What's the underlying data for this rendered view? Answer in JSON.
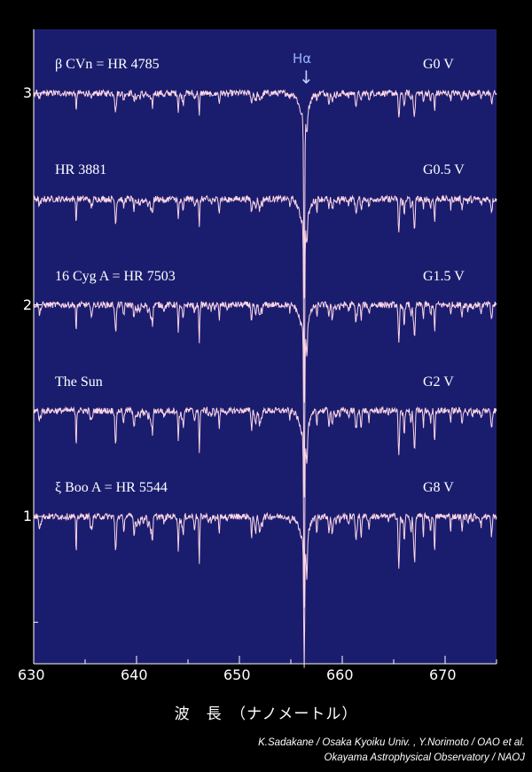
{
  "chart_data": {
    "type": "line",
    "title": "",
    "xlabel": "波　長　（ナノメートル）",
    "ylabel": "",
    "xlim": [
      630,
      675
    ],
    "ylim": [
      0.2,
      3.6
    ],
    "x_ticks": [
      "630",
      "640",
      "650",
      "660",
      "670"
    ],
    "y_ticks": [
      "1",
      "2",
      "3"
    ],
    "grid": false,
    "annotation": {
      "label": "Hα",
      "arrow": "↓",
      "x": 656.3
    },
    "series": [
      {
        "name": "β CVn = HR 4785",
        "spectral_type": "G0 V",
        "continuum": 3.0,
        "halpha_depth": 0.85
      },
      {
        "name": "HR 3881",
        "spectral_type": "G0.5 V",
        "continuum": 2.5,
        "halpha_depth": 0.85
      },
      {
        "name": "16 Cyg A = HR 7503",
        "spectral_type": "G1.5 V",
        "continuum": 2.0,
        "halpha_depth": 0.8
      },
      {
        "name": "The Sun",
        "spectral_type": "G2 V",
        "continuum": 1.5,
        "halpha_depth": 0.8
      },
      {
        "name": "ξ Boo A = HR 5544",
        "spectral_type": "G8 V",
        "continuum": 1.0,
        "halpha_depth": 0.6
      }
    ],
    "colors": {
      "plot_background": "#1a1d6e",
      "line": "#ffd6e6",
      "axis": "#ffffff",
      "page_background": "#000000"
    }
  },
  "credits": {
    "line1": "K.Sadakane / Osaka Kyoiku Univ. , Y.Norimoto / OAO et al.",
    "line2": "Okayama Astrophysical Observatory / NAOJ"
  }
}
